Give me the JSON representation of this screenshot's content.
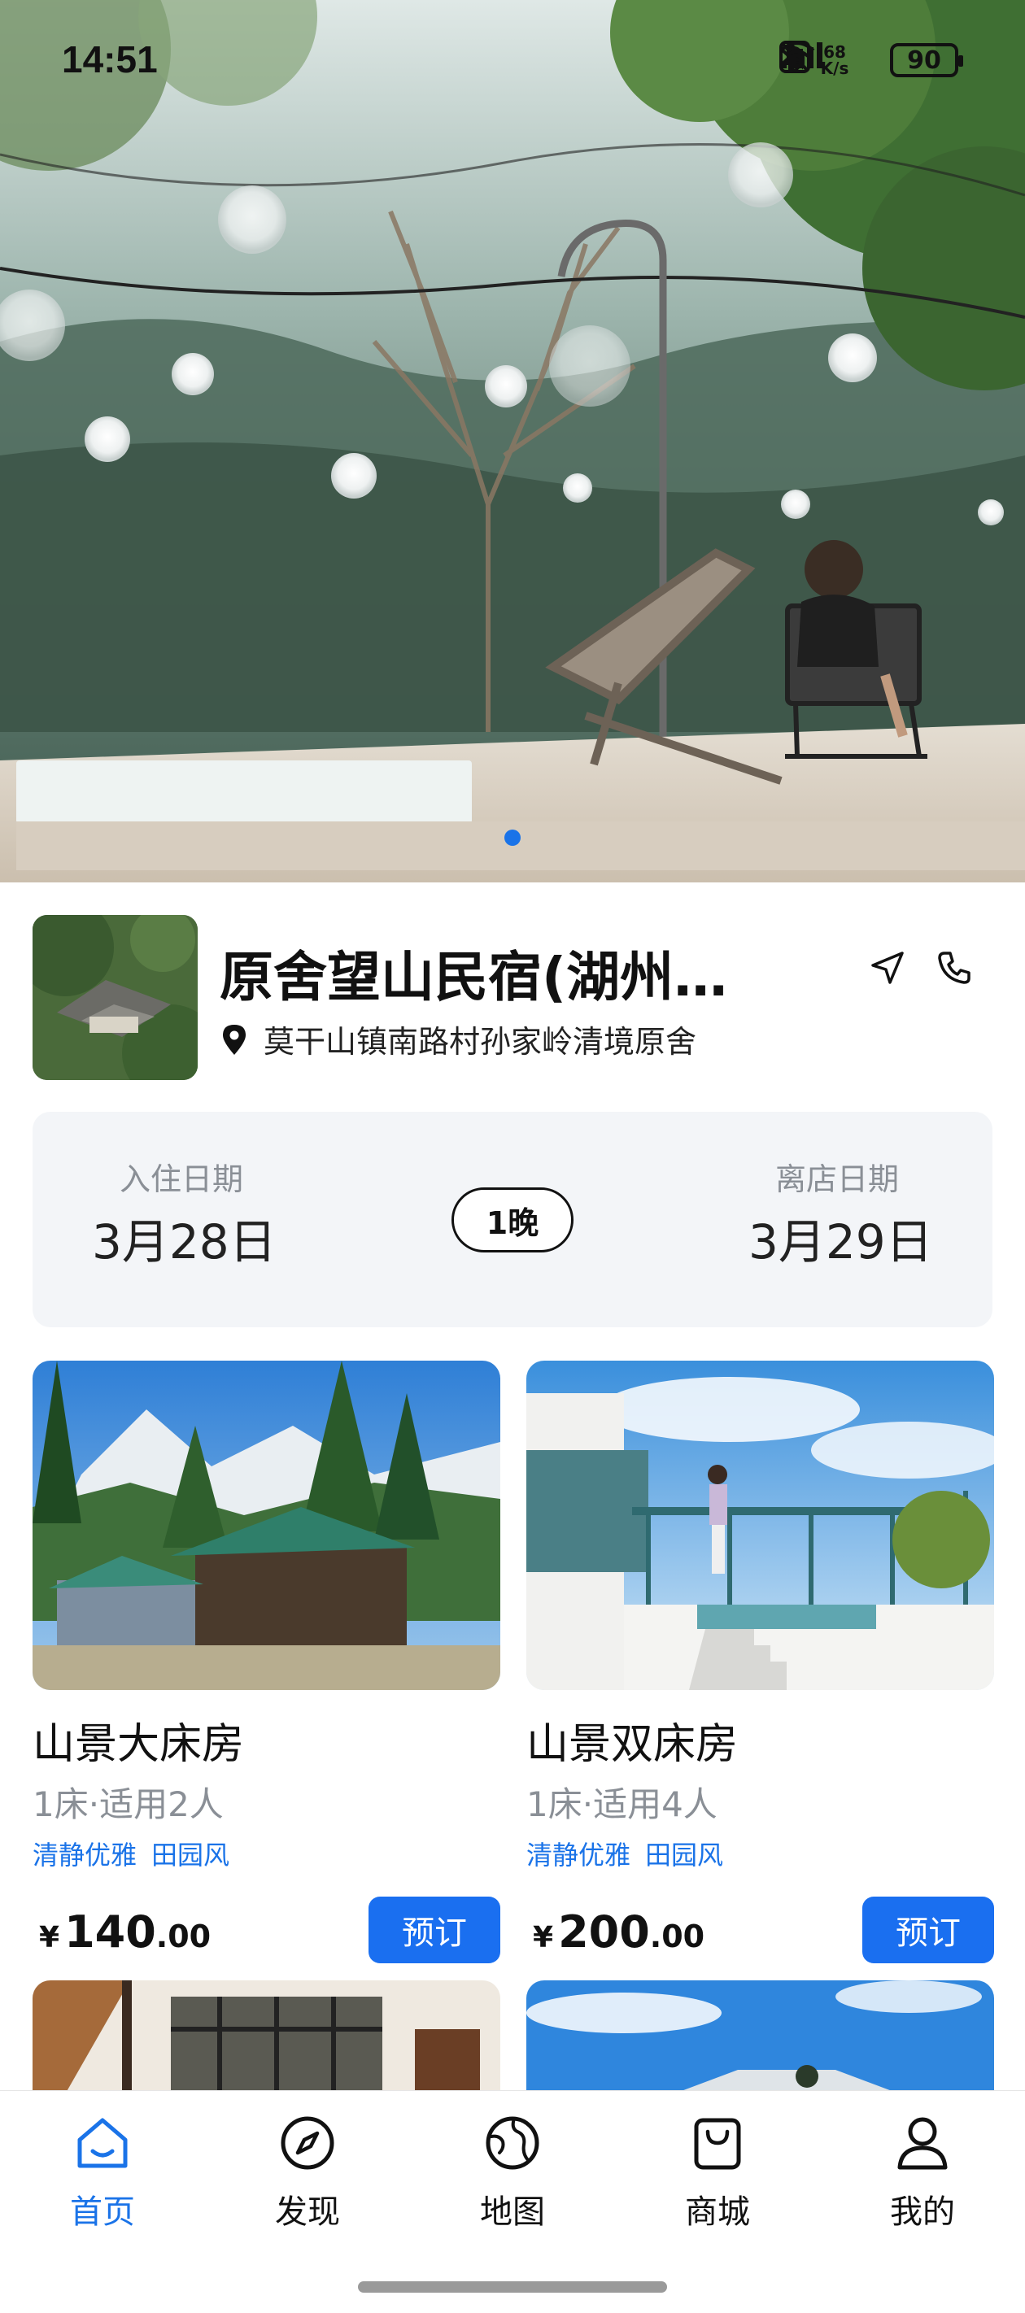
{
  "status_bar": {
    "time": "14:51",
    "net_speed_top": "68",
    "net_speed_unit": "K/s",
    "battery": "90",
    "icons": [
      "nfc-icon",
      "bluetooth-icon",
      "mute-icon",
      "wifi-icon",
      "signal-icon"
    ]
  },
  "hotel": {
    "name": "原舍望山民宿(湖州…",
    "address": "莫干山镇南路村孙家岭清境原舍"
  },
  "dates": {
    "checkin_label": "入住日期",
    "checkin_value": "3月28日",
    "nights": "1晚",
    "checkout_label": "离店日期",
    "checkout_value": "3月29日"
  },
  "rooms": [
    {
      "title": "山景大床房",
      "spec": "1床·适用2人",
      "tags": [
        "清静优雅",
        "田园风"
      ],
      "currency": "¥",
      "price_int": "140",
      "price_dec": ".00",
      "book_label": "预订"
    },
    {
      "title": "山景双床房",
      "spec": "1床·适用4人",
      "tags": [
        "清静优雅",
        "田园风"
      ],
      "currency": "¥",
      "price_int": "200",
      "price_dec": ".00",
      "book_label": "预订"
    }
  ],
  "nav": {
    "items": [
      {
        "label": "首页",
        "icon": "home-icon",
        "active": true
      },
      {
        "label": "发现",
        "icon": "compass-icon",
        "active": false
      },
      {
        "label": "地图",
        "icon": "globe-icon",
        "active": false
      },
      {
        "label": "商城",
        "icon": "shopping-bag-icon",
        "active": false
      },
      {
        "label": "我的",
        "icon": "person-icon",
        "active": false
      }
    ]
  },
  "colors": {
    "accent": "#1a73e8",
    "book_button": "#1a6ff0",
    "tag": "#1a73e8",
    "muted": "#8a8f96",
    "date_card_bg": "#f3f5f8"
  }
}
